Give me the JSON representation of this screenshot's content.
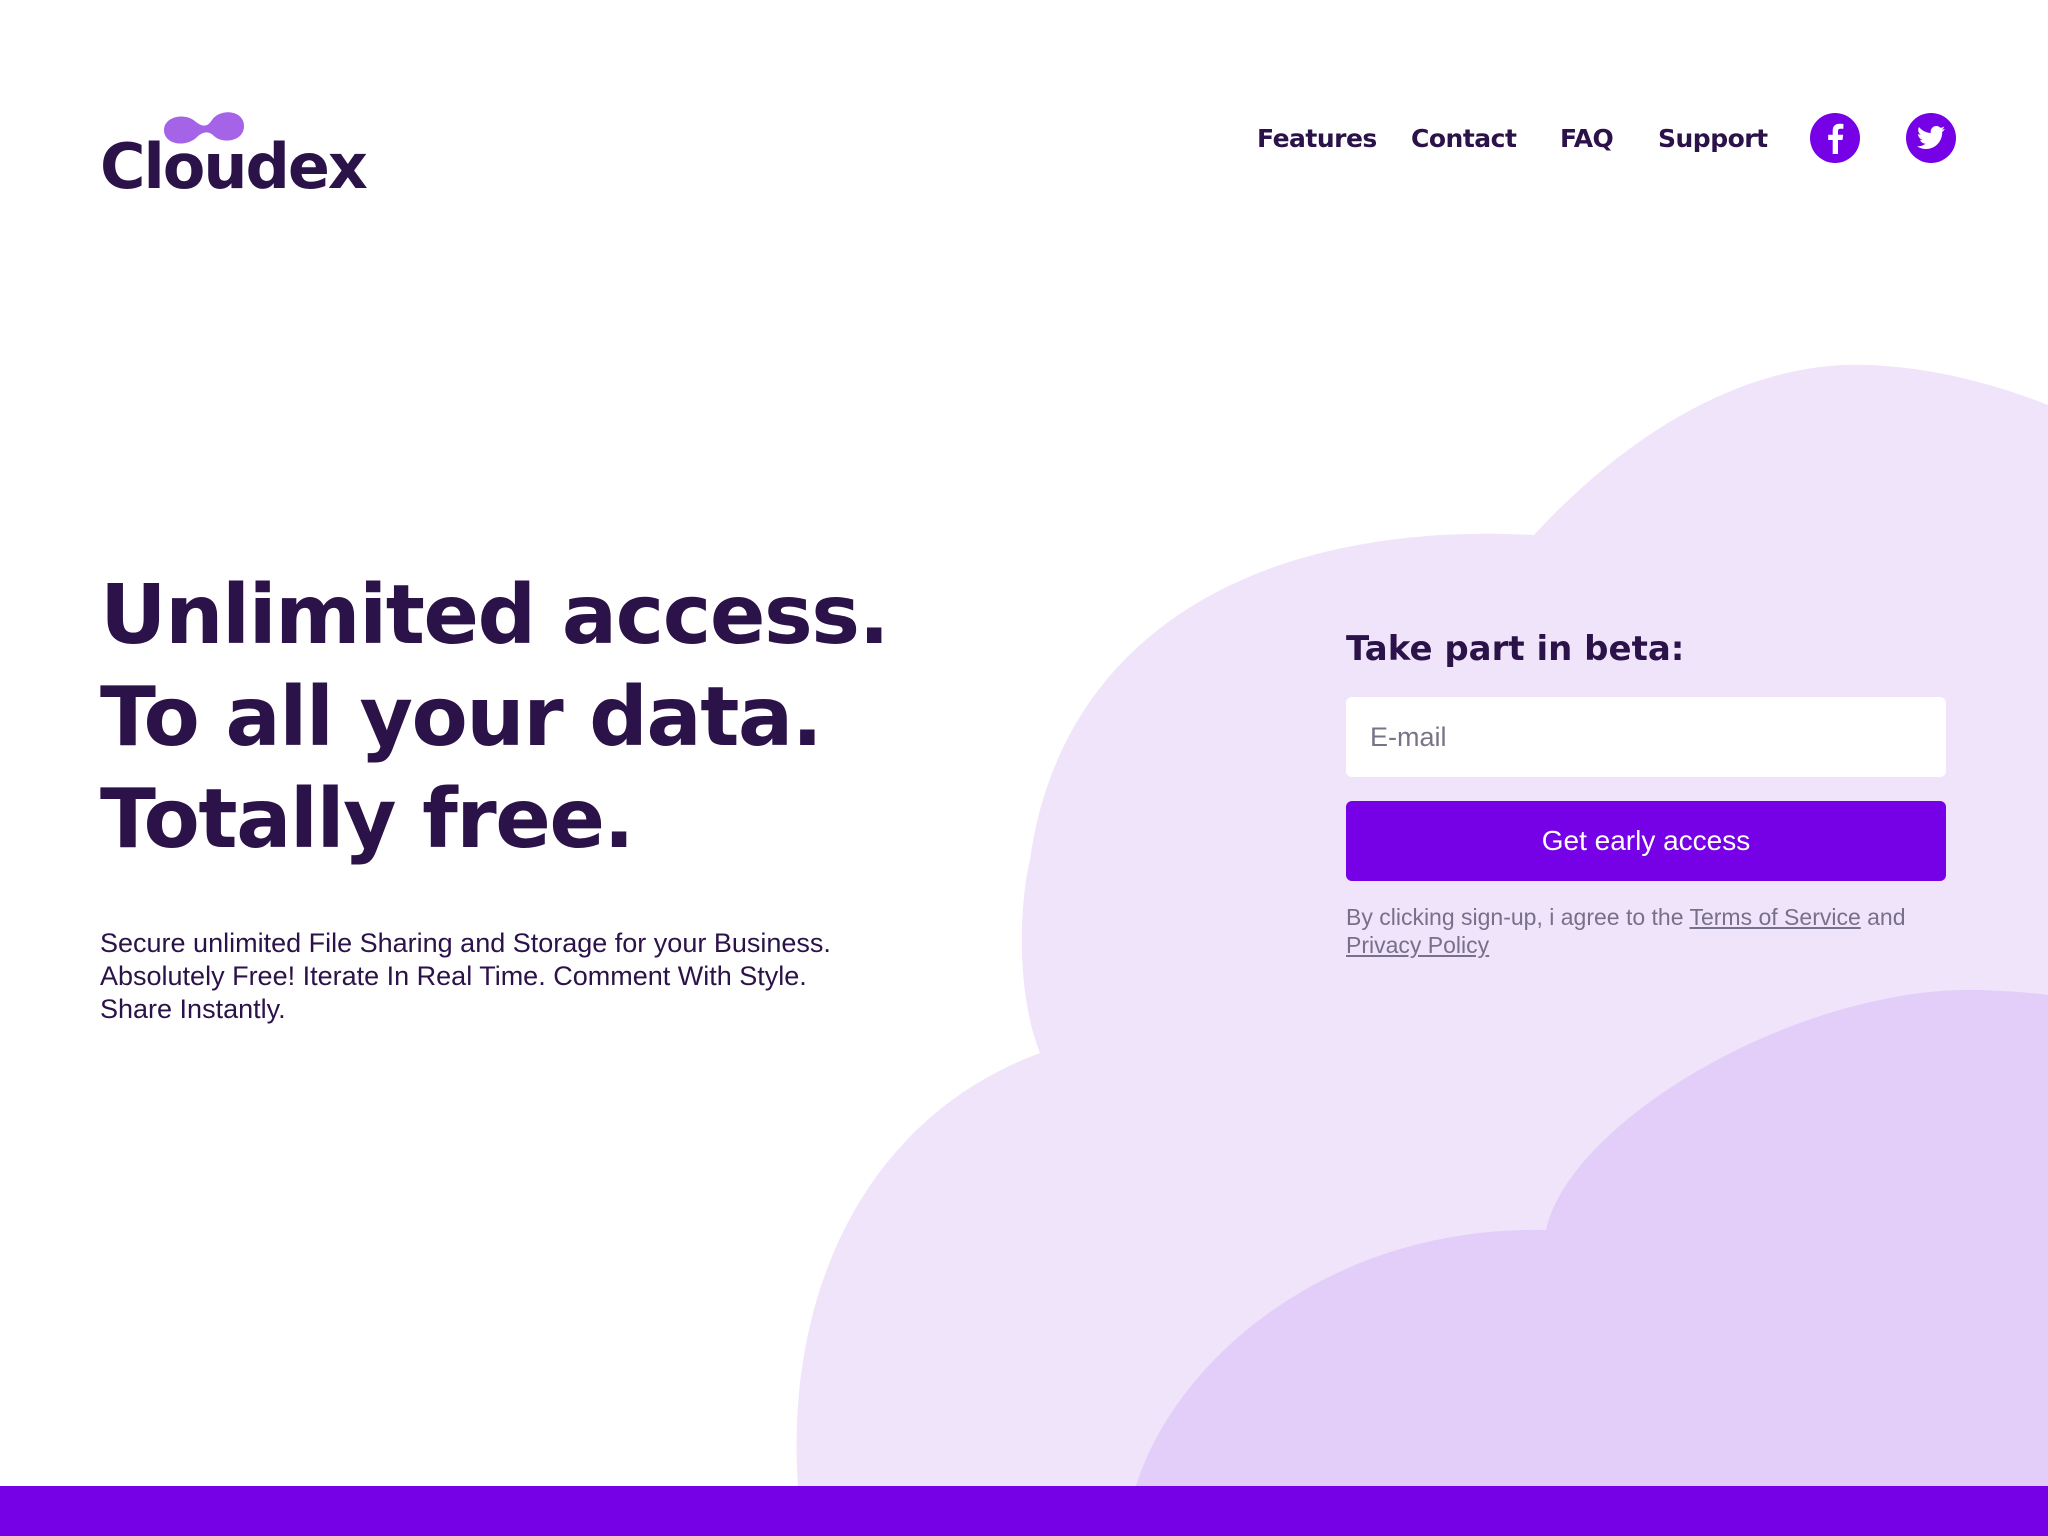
{
  "brand": {
    "name": "Cloudex",
    "logo_icon": "cloud-blob-icon"
  },
  "nav": {
    "items": [
      {
        "label": "Features"
      },
      {
        "label": "Contact"
      },
      {
        "label": "FAQ"
      },
      {
        "label": "Support"
      }
    ],
    "social": [
      {
        "icon": "facebook-icon"
      },
      {
        "icon": "twitter-icon"
      }
    ]
  },
  "hero": {
    "headline": [
      "Unlimited access.",
      "To all your data.",
      "Totally free."
    ],
    "description": "Secure unlimited File Sharing and Storage for your Business. Absolutely Free! Iterate In Real Time. Comment With Style. Share Instantly."
  },
  "signup": {
    "title": "Take part in beta:",
    "email_placeholder": "E-mail",
    "email_value": "",
    "button_label": "Get early access",
    "legal_prefix": "By clicking sign-up, i agree to the ",
    "terms_label": "Terms of Service",
    "legal_and": " and ",
    "privacy_label": "Privacy Policy"
  },
  "colors": {
    "primary": "#7600e6",
    "text_dark": "#2b1248",
    "cloud_light": "#f0e4fb",
    "cloud_medium": "#e2cef9",
    "logo_mark": "#a564e8",
    "muted_text": "#77708a"
  }
}
